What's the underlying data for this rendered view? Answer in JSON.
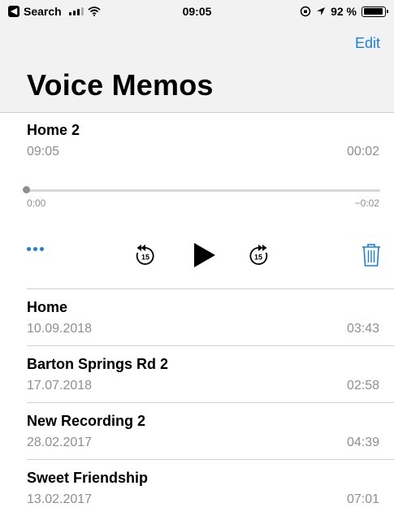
{
  "status_bar": {
    "back_label": "Search",
    "time": "09:05",
    "battery": "92 %",
    "battery_level": 0.92
  },
  "header": {
    "edit_label": "Edit",
    "title": "Voice Memos"
  },
  "expanded_memo": {
    "name": "Home 2",
    "date": "09:05",
    "duration": "00:02",
    "elapsed": "0:00",
    "remaining": "−0:02",
    "skip_back_label": "15",
    "skip_forward_label": "15"
  },
  "memos": [
    {
      "name": "Home",
      "date": "10.09.2018",
      "duration": "03:43"
    },
    {
      "name": "Barton Springs Rd 2",
      "date": "17.07.2018",
      "duration": "02:58"
    },
    {
      "name": "New Recording 2",
      "date": "28.02.2017",
      "duration": "04:39"
    },
    {
      "name": "Sweet Friendship",
      "date": "13.02.2017",
      "duration": "07:01"
    }
  ],
  "colors": {
    "accent": "#1a7fe0",
    "secondary_text": "#8e8e93",
    "header_bg": "#f2f2f2"
  }
}
